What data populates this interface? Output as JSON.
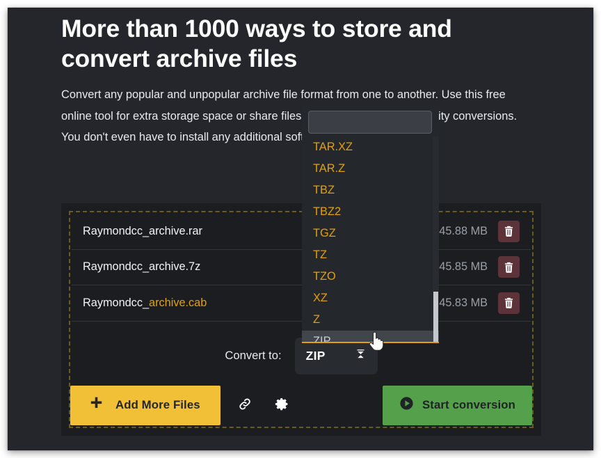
{
  "page": {
    "heading": "More than 1000 ways to store and convert archive files",
    "intro": "Convert any popular and unpopular archive file format from one to another. Use this free online tool for extra storage space or share files with the best possible quality conversions. You don't even have to install any additional software."
  },
  "files": [
    {
      "name_prefix": "Raymondcc_",
      "name_suffix": "archive.rar",
      "suffix_highlighted": false,
      "size": "45.88 MB",
      "delete_icon": "trash-icon"
    },
    {
      "name_prefix": "Raymondcc_",
      "name_suffix": "archive.7z",
      "suffix_highlighted": false,
      "size": "45.85 MB",
      "delete_icon": "trash-icon"
    },
    {
      "name_prefix": "Raymondcc_",
      "name_suffix": "archive.cab",
      "suffix_highlighted": true,
      "size": "45.83 MB",
      "delete_icon": "trash-icon"
    }
  ],
  "convert": {
    "label": "Convert to:",
    "selected_format": "ZIP",
    "caret_icon": "collapse-arrows-icon"
  },
  "dropdown": {
    "search_value": "",
    "search_placeholder": "",
    "items": [
      {
        "label": "TAR.XZ",
        "selected": false
      },
      {
        "label": "TAR.Z",
        "selected": false
      },
      {
        "label": "TBZ",
        "selected": false
      },
      {
        "label": "TBZ2",
        "selected": false
      },
      {
        "label": "TGZ",
        "selected": false
      },
      {
        "label": "TZ",
        "selected": false
      },
      {
        "label": "TZO",
        "selected": false
      },
      {
        "label": "XZ",
        "selected": false
      },
      {
        "label": "Z",
        "selected": false
      },
      {
        "label": "ZIP",
        "selected": true
      }
    ]
  },
  "actions": {
    "add_files_label": "Add More Files",
    "add_files_icon": "plus-icon",
    "link_icon": "link-icon",
    "settings_icon": "gear-icon",
    "start_label": "Start conversion",
    "start_icon": "play-circle-icon"
  },
  "colors": {
    "accent_yellow": "#f2c037",
    "item_yellow": "#e3a008",
    "green": "#55a04a",
    "delete_red": "#5c3338",
    "panel_bg": "#1b1d21",
    "page_bg": "#24262b",
    "dashed_border": "#6b5c1e"
  }
}
